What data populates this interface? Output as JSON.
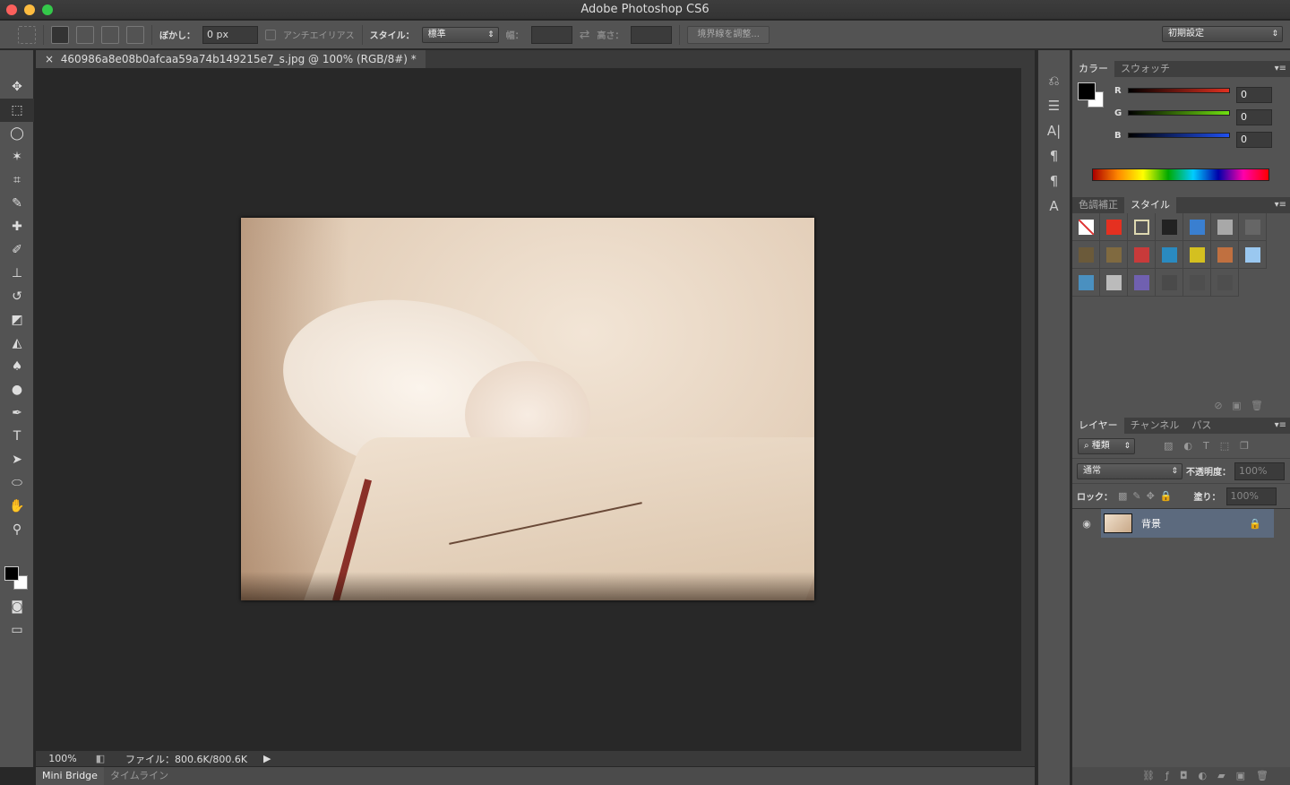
{
  "window": {
    "title": "Adobe Photoshop CS6"
  },
  "options": {
    "feather_label": "ぼかし：",
    "feather_value": "0 px",
    "antialias_label": "アンチエイリアス",
    "style_label": "スタイル：",
    "style_value": "標準",
    "width_label": "幅：",
    "height_label": "高さ：",
    "refine_edge": "境界線を調整...",
    "workspace": "初期設定"
  },
  "document": {
    "tab_title": "460986a8e08b0afcaa59a74b149215e7_s.jpg @ 100% (RGB/8#) *"
  },
  "tools": [
    "move-icon",
    "marquee-icon",
    "lasso-icon",
    "magic-wand-icon",
    "crop-icon",
    "eyedropper-icon",
    "healing-brush-icon",
    "brush-icon",
    "stamp-icon",
    "history-brush-icon",
    "eraser-icon",
    "paint-bucket-icon",
    "blur-icon",
    "dodge-icon",
    "pen-icon",
    "type-icon",
    "path-select-icon",
    "ellipse-icon",
    "hand-icon",
    "zoom-icon"
  ],
  "status": {
    "zoom": "100%",
    "file_info": "ファイル：800.6K/800.6K"
  },
  "bottom_tabs": [
    "Mini Bridge",
    "タイムライン"
  ],
  "color_panel": {
    "tabs": [
      "カラー",
      "スウォッチ"
    ],
    "channels": [
      {
        "label": "R",
        "value": "0",
        "color": "#e03020"
      },
      {
        "label": "G",
        "value": "0",
        "color": "#70e010"
      },
      {
        "label": "B",
        "value": "0",
        "color": "#2050f0"
      }
    ]
  },
  "style_panel": {
    "tabs": [
      "色調補正",
      "スタイル"
    ],
    "swatches": [
      "#ffffff",
      "#e53020",
      "#555555",
      "#222222",
      "#3a7fd0",
      "#a8a8a8",
      "#666666",
      "#6b5a3a",
      "#806a40",
      "#c83a3a",
      "#2a8ac0",
      "#d4c020",
      "#c07040",
      "#9ac8f0",
      "#4a90c0",
      "#bbbbbb",
      "#7060b0",
      "#4a4a4a",
      "#4e4e4e",
      "#4e4e4e"
    ]
  },
  "layers_panel": {
    "tabs": [
      "レイヤー",
      "チャンネル",
      "パス"
    ],
    "filter": "種類",
    "blend_mode": "通常",
    "opacity_label": "不透明度：",
    "opacity": "100%",
    "lock_label": "ロック：",
    "fill_label": "塗り：",
    "fill": "100%",
    "layers": [
      {
        "name": "背景",
        "locked": true,
        "visible": true
      }
    ]
  }
}
